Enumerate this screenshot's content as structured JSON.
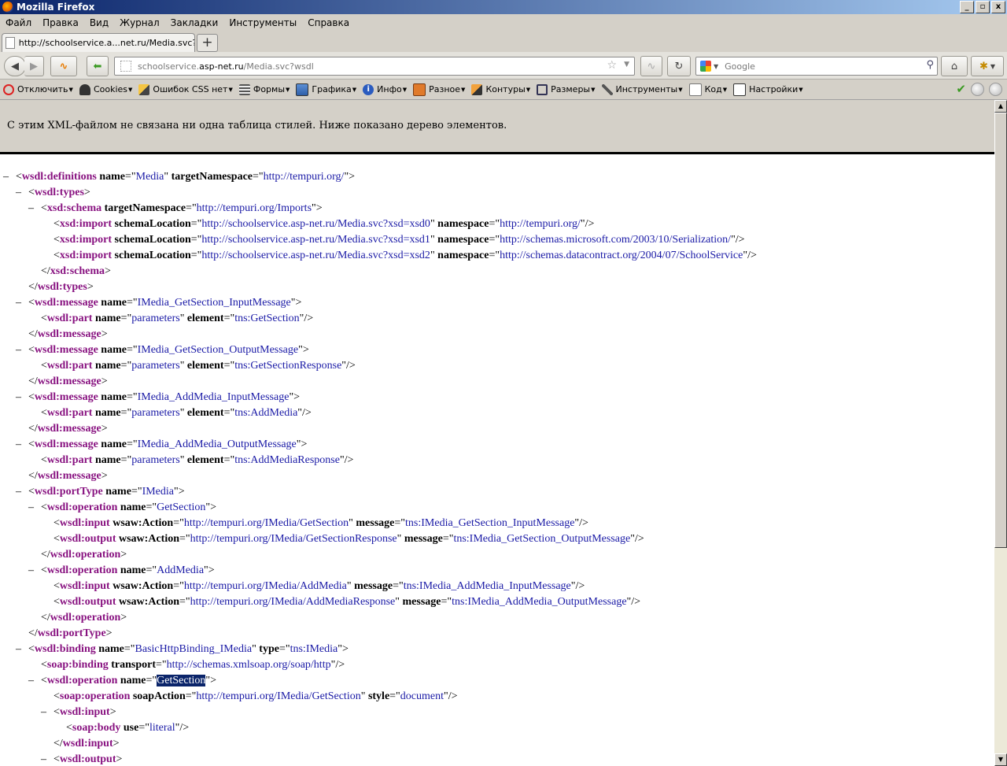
{
  "window": {
    "title": "Mozilla Firefox",
    "minimize": "_",
    "restore": "▫",
    "close": "x"
  },
  "menu": [
    "Файл",
    "Правка",
    "Вид",
    "Журнал",
    "Закладки",
    "Инструменты",
    "Справка"
  ],
  "tab": {
    "title": "http://schoolservice.a...net.ru/Media.svc?wsdl",
    "new_tab": "+"
  },
  "nav": {
    "url_prefix": "schoolservice.",
    "url_domain": "asp-net.ru",
    "url_path": "/Media.svc?wsdl",
    "search_placeholder": "Google"
  },
  "webdev": [
    {
      "label": "Отключить",
      "icon": "disable-icon"
    },
    {
      "label": "Cookies",
      "icon": "person-icon"
    },
    {
      "label": "Ошибок CSS нет",
      "icon": "pencil-icon"
    },
    {
      "label": "Формы",
      "icon": "form-icon"
    },
    {
      "label": "Графика",
      "icon": "image-icon"
    },
    {
      "label": "Инфо",
      "icon": "info-icon"
    },
    {
      "label": "Разное",
      "icon": "misc-icon"
    },
    {
      "label": "Контуры",
      "icon": "outline-icon"
    },
    {
      "label": "Размеры",
      "icon": "resize-icon"
    },
    {
      "label": "Инструменты",
      "icon": "tools-icon"
    },
    {
      "label": "Код",
      "icon": "code-icon"
    },
    {
      "label": "Настройки",
      "icon": "settings-icon"
    }
  ],
  "notice": "С этим XML-файлом не связана ни одна таблица стилей. Ниже показано дерево элементов.",
  "colors": {
    "tag": "#881280",
    "value": "#1a1aa6",
    "header_bg": "#d4d0c8"
  },
  "xml": [
    {
      "i": 0,
      "t": "-",
      "open": true,
      "tag": "wsdl:definitions",
      "a": [
        [
          "name",
          "Media"
        ],
        [
          "targetNamespace",
          "http://tempuri.org/"
        ]
      ]
    },
    {
      "i": 1,
      "t": "-",
      "open": true,
      "tag": "wsdl:types",
      "a": []
    },
    {
      "i": 2,
      "t": "-",
      "open": true,
      "tag": "xsd:schema",
      "a": [
        [
          "targetNamespace",
          "http://tempuri.org/Imports"
        ]
      ]
    },
    {
      "i": 3,
      "t": "",
      "self": true,
      "tag": "xsd:import",
      "a": [
        [
          "schemaLocation",
          "http://schoolservice.asp-net.ru/Media.svc?xsd=xsd0"
        ],
        [
          "namespace",
          "http://tempuri.org/"
        ]
      ]
    },
    {
      "i": 3,
      "t": "",
      "self": true,
      "tag": "xsd:import",
      "a": [
        [
          "schemaLocation",
          "http://schoolservice.asp-net.ru/Media.svc?xsd=xsd1"
        ],
        [
          "namespace",
          "http://schemas.microsoft.com/2003/10/Serialization/"
        ]
      ]
    },
    {
      "i": 3,
      "t": "",
      "self": true,
      "tag": "xsd:import",
      "a": [
        [
          "schemaLocation",
          "http://schoolservice.asp-net.ru/Media.svc?xsd=xsd2"
        ],
        [
          "namespace",
          "http://schemas.datacontract.org/2004/07/SchoolService"
        ]
      ]
    },
    {
      "i": 2,
      "t": "",
      "close": true,
      "tag": "xsd:schema"
    },
    {
      "i": 1,
      "t": "",
      "close": true,
      "tag": "wsdl:types"
    },
    {
      "i": 1,
      "t": "-",
      "open": true,
      "tag": "wsdl:message",
      "a": [
        [
          "name",
          "IMedia_GetSection_InputMessage"
        ]
      ]
    },
    {
      "i": 2,
      "t": "",
      "self": true,
      "tag": "wsdl:part",
      "a": [
        [
          "name",
          "parameters"
        ],
        [
          "element",
          "tns:GetSection"
        ]
      ]
    },
    {
      "i": 1,
      "t": "",
      "close": true,
      "tag": "wsdl:message"
    },
    {
      "i": 1,
      "t": "-",
      "open": true,
      "tag": "wsdl:message",
      "a": [
        [
          "name",
          "IMedia_GetSection_OutputMessage"
        ]
      ]
    },
    {
      "i": 2,
      "t": "",
      "self": true,
      "tag": "wsdl:part",
      "a": [
        [
          "name",
          "parameters"
        ],
        [
          "element",
          "tns:GetSectionResponse"
        ]
      ]
    },
    {
      "i": 1,
      "t": "",
      "close": true,
      "tag": "wsdl:message"
    },
    {
      "i": 1,
      "t": "-",
      "open": true,
      "tag": "wsdl:message",
      "a": [
        [
          "name",
          "IMedia_AddMedia_InputMessage"
        ]
      ]
    },
    {
      "i": 2,
      "t": "",
      "self": true,
      "tag": "wsdl:part",
      "a": [
        [
          "name",
          "parameters"
        ],
        [
          "element",
          "tns:AddMedia"
        ]
      ]
    },
    {
      "i": 1,
      "t": "",
      "close": true,
      "tag": "wsdl:message"
    },
    {
      "i": 1,
      "t": "-",
      "open": true,
      "tag": "wsdl:message",
      "a": [
        [
          "name",
          "IMedia_AddMedia_OutputMessage"
        ]
      ]
    },
    {
      "i": 2,
      "t": "",
      "self": true,
      "tag": "wsdl:part",
      "a": [
        [
          "name",
          "parameters"
        ],
        [
          "element",
          "tns:AddMediaResponse"
        ]
      ]
    },
    {
      "i": 1,
      "t": "",
      "close": true,
      "tag": "wsdl:message"
    },
    {
      "i": 1,
      "t": "-",
      "open": true,
      "tag": "wsdl:portType",
      "a": [
        [
          "name",
          "IMedia"
        ]
      ]
    },
    {
      "i": 2,
      "t": "-",
      "open": true,
      "tag": "wsdl:operation",
      "a": [
        [
          "name",
          "GetSection"
        ]
      ]
    },
    {
      "i": 3,
      "t": "",
      "self": true,
      "tag": "wsdl:input",
      "a": [
        [
          "wsaw:Action",
          "http://tempuri.org/IMedia/GetSection"
        ],
        [
          "message",
          "tns:IMedia_GetSection_InputMessage"
        ]
      ]
    },
    {
      "i": 3,
      "t": "",
      "self": true,
      "tag": "wsdl:output",
      "a": [
        [
          "wsaw:Action",
          "http://tempuri.org/IMedia/GetSectionResponse"
        ],
        [
          "message",
          "tns:IMedia_GetSection_OutputMessage"
        ]
      ]
    },
    {
      "i": 2,
      "t": "",
      "close": true,
      "tag": "wsdl:operation"
    },
    {
      "i": 2,
      "t": "-",
      "open": true,
      "tag": "wsdl:operation",
      "a": [
        [
          "name",
          "AddMedia"
        ]
      ]
    },
    {
      "i": 3,
      "t": "",
      "self": true,
      "tag": "wsdl:input",
      "a": [
        [
          "wsaw:Action",
          "http://tempuri.org/IMedia/AddMedia"
        ],
        [
          "message",
          "tns:IMedia_AddMedia_InputMessage"
        ]
      ]
    },
    {
      "i": 3,
      "t": "",
      "self": true,
      "tag": "wsdl:output",
      "a": [
        [
          "wsaw:Action",
          "http://tempuri.org/IMedia/AddMediaResponse"
        ],
        [
          "message",
          "tns:IMedia_AddMedia_OutputMessage"
        ]
      ]
    },
    {
      "i": 2,
      "t": "",
      "close": true,
      "tag": "wsdl:operation"
    },
    {
      "i": 1,
      "t": "",
      "close": true,
      "tag": "wsdl:portType"
    },
    {
      "i": 1,
      "t": "-",
      "open": true,
      "tag": "wsdl:binding",
      "a": [
        [
          "name",
          "BasicHttpBinding_IMedia"
        ],
        [
          "type",
          "tns:IMedia"
        ]
      ]
    },
    {
      "i": 2,
      "t": "",
      "self": true,
      "tag": "soap:binding",
      "a": [
        [
          "transport",
          "http://schemas.xmlsoap.org/soap/http"
        ]
      ]
    },
    {
      "i": 2,
      "t": "-",
      "open": true,
      "tag": "wsdl:operation",
      "a": [
        [
          "name",
          "GetSection"
        ]
      ],
      "selected": true
    },
    {
      "i": 3,
      "t": "",
      "self": true,
      "tag": "soap:operation",
      "a": [
        [
          "soapAction",
          "http://tempuri.org/IMedia/GetSection"
        ],
        [
          "style",
          "document"
        ]
      ]
    },
    {
      "i": 3,
      "t": "-",
      "open": true,
      "tag": "wsdl:input",
      "a": []
    },
    {
      "i": 4,
      "t": "",
      "self": true,
      "tag": "soap:body",
      "a": [
        [
          "use",
          "literal"
        ]
      ]
    },
    {
      "i": 3,
      "t": "",
      "close": true,
      "tag": "wsdl:input"
    },
    {
      "i": 3,
      "t": "-",
      "open": true,
      "tag": "wsdl:output",
      "a": []
    }
  ]
}
